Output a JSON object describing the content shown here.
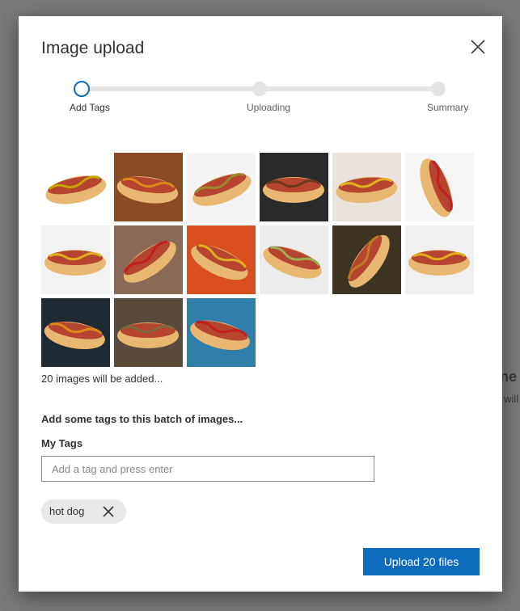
{
  "background": {
    "heading_fragment": "ne",
    "text_fragment": "will"
  },
  "dialog": {
    "title": "Image upload",
    "close_icon": "close-icon"
  },
  "steps": [
    {
      "label": "Add Tags",
      "state": "active"
    },
    {
      "label": "Uploading",
      "state": "pending"
    },
    {
      "label": "Summary",
      "state": "pending"
    }
  ],
  "thumbnails": [
    {
      "name": "hot dog image 1"
    },
    {
      "name": "hot dog image 2"
    },
    {
      "name": "hot dog image 3"
    },
    {
      "name": "hot dog image 4"
    },
    {
      "name": "hot dog image 5"
    },
    {
      "name": "hot dog image 6"
    },
    {
      "name": "hot dog image 7"
    },
    {
      "name": "hot dog image 8"
    },
    {
      "name": "hot dog image 9"
    },
    {
      "name": "hot dog image 10"
    },
    {
      "name": "hot dog image 11"
    },
    {
      "name": "hot dog image 12"
    },
    {
      "name": "hot dog image 13"
    },
    {
      "name": "hot dog image 14"
    },
    {
      "name": "hot dog image 15"
    }
  ],
  "images_count_text": "20 images will be added...",
  "tags_prompt": "Add some tags to this batch of images...",
  "my_tags_label": "My Tags",
  "tag_input": {
    "placeholder": "Add a tag and press enter",
    "value": ""
  },
  "tags": [
    {
      "label": "hot dog"
    }
  ],
  "upload_button": "Upload 20 files",
  "colors": {
    "accent": "#0f6cbd",
    "chip": "#e8e8e8",
    "track": "#e4e4e4"
  }
}
